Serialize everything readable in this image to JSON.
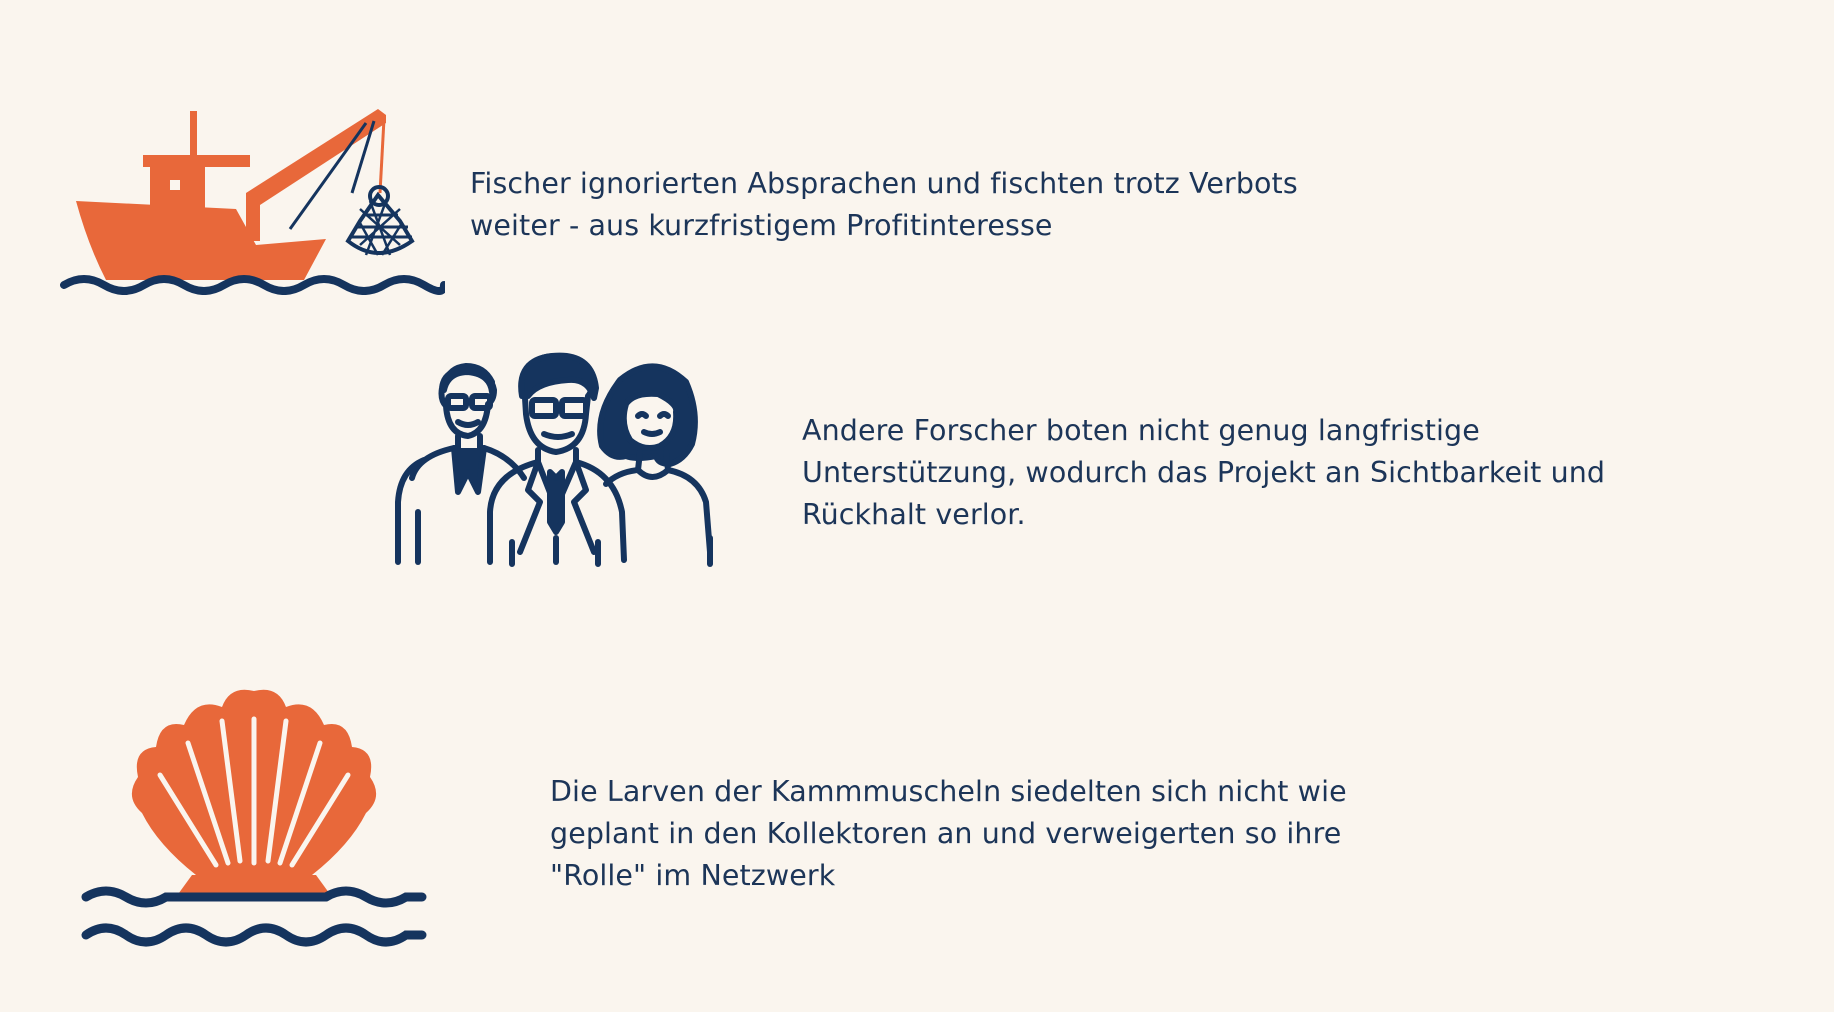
{
  "colors": {
    "background": "#faf5ee",
    "text": "#1c3558",
    "accent_orange": "#e8683a",
    "navy": "#15345e"
  },
  "items": [
    {
      "icon": "fishing-boat-icon",
      "lines": [
        "Fischer ignorierten Absprachen und fischten trotz Verbots",
        "weiter - aus kurzfristigem Profitinteresse"
      ]
    },
    {
      "icon": "researchers-icon",
      "lines": [
        "Andere Forscher boten nicht genug langfristige",
        "Unterstützung, wodurch das Projekt an Sichtbarkeit und",
        "Rückhalt verlor."
      ]
    },
    {
      "icon": "scallop-shell-icon",
      "lines": [
        "Die Larven der Kammmuscheln siedelten sich nicht wie",
        "geplant in den Kollektoren an und verweigerten so ihre",
        "\"Rolle\" im Netzwerk"
      ]
    }
  ]
}
